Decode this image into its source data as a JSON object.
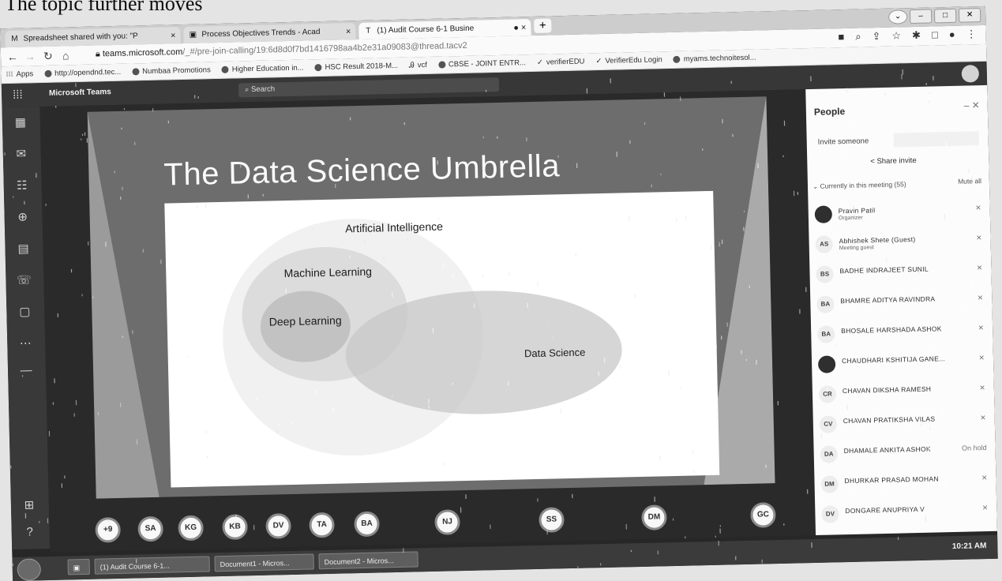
{
  "document_text": "The topic further moves",
  "browser": {
    "tabs": [
      {
        "icon": "gmail-icon",
        "label": "Spreadsheet shared with you: \"P"
      },
      {
        "icon": "slides-icon",
        "label": "Process Objectives Trends - Acad"
      },
      {
        "icon": "teams-icon",
        "label": "(1) Audit Course 6-1 Busine"
      }
    ],
    "new_tab": "+",
    "url_host": "teams.microsoft.com",
    "url_path": "/_#/pre-join-calling/19:6d8d0f7bd1416798aa4b2e31a09083@thread.tacv2",
    "bookmarks": [
      "Apps",
      "http://opendnd.tec...",
      "Numbaa Promotions",
      "Higher Education in...",
      "HSC Result 2018-M...",
      "vcf",
      "CBSE - JOINT ENTR...",
      "verifierEDU",
      "VerifierEdu Login",
      "myams.technoitesol..."
    ]
  },
  "teams": {
    "app_title": "Microsoft Teams",
    "search_placeholder": "Search"
  },
  "slide": {
    "title": "The Data Science Umbrella",
    "labels": {
      "ai": "Artificial Intelligence",
      "ml": "Machine Learning",
      "dl": "Deep Learning",
      "ds": "Data Science"
    }
  },
  "participants_row": [
    "+9",
    "SA",
    "KG",
    "KB",
    "DV",
    "TA",
    "BA",
    "NJ",
    "SS",
    "DM",
    "GC"
  ],
  "people_panel": {
    "title": "People",
    "invite_label": "Invite someone",
    "share_invite": "Share invite",
    "current_label": "Currently in this meeting (55)",
    "mute_all": "Mute all",
    "people": [
      {
        "initials": "",
        "name": "Pravin Patil",
        "role": "Organizer",
        "dark": true,
        "mic": "✕"
      },
      {
        "initials": "AS",
        "name": "Abhishek Shete (Guest)",
        "role": "Meeting guest",
        "dark": false,
        "mic": "✕"
      },
      {
        "initials": "BS",
        "name": "BADHE INDRAJEET SUNIL",
        "role": "",
        "dark": false,
        "mic": "✕"
      },
      {
        "initials": "BA",
        "name": "BHAMRE ADITYA RAVINDRA",
        "role": "",
        "dark": false,
        "mic": "✕"
      },
      {
        "initials": "BA",
        "name": "BHOSALE HARSHADA ASHOK",
        "role": "",
        "dark": false,
        "mic": "✕"
      },
      {
        "initials": "",
        "name": "CHAUDHARI KSHITIJA GANE...",
        "role": "",
        "dark": true,
        "mic": "✕"
      },
      {
        "initials": "CR",
        "name": "CHAVAN DIKSHA RAMESH",
        "role": "",
        "dark": false,
        "mic": "✕"
      },
      {
        "initials": "CV",
        "name": "CHAVAN PRATIKSHA VILAS",
        "role": "",
        "dark": false,
        "mic": "✕"
      },
      {
        "initials": "DA",
        "name": "DHAMALE ANKITA ASHOK",
        "role": "",
        "dark": false,
        "mic": "On hold"
      },
      {
        "initials": "DM",
        "name": "DHURKAR PRASAD MOHAN",
        "role": "",
        "dark": false,
        "mic": "✕"
      },
      {
        "initials": "DV",
        "name": "DONGARE ANUPRIYA V",
        "role": "",
        "dark": false,
        "mic": "✕"
      }
    ]
  },
  "taskbar": {
    "items": [
      "(1) Audit Course 6-1...",
      "Document1 - Micros...",
      "Document2 - Micros..."
    ],
    "clock": "10:21 AM"
  },
  "colors": {
    "teams_header": "#3a3a3a",
    "slide_bg": "#6e6e6e",
    "panel_bg": "#f6f6f6"
  }
}
